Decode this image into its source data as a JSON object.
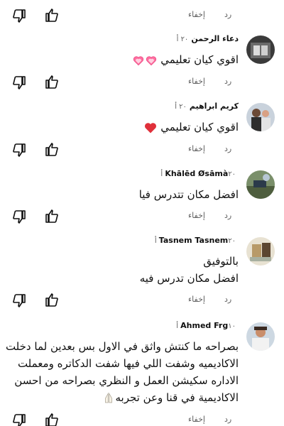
{
  "actions": {
    "reply_label": "رد",
    "hide_label": "إخفاء"
  },
  "comments": [
    {
      "author": "دعاء الرحمن",
      "time": "٢٠ أ",
      "lines": [
        "اقوي كيان تعليمي"
      ]
    },
    {
      "author": "كريم ابراهيم",
      "time": "٢٠ أ",
      "lines": [
        "اقوي كيان تعليمي"
      ]
    },
    {
      "author": "Khālēd Øsāmà",
      "time": "٢٠ أ",
      "lines": [
        "افضل مكان تتدرس فيا"
      ]
    },
    {
      "author": "Tasnem Tasnem",
      "time": "٢٠ أ",
      "lines": [
        "بالتوفيق",
        "افضل مكان تدرس فيه"
      ]
    },
    {
      "author": "Ahmed Frg",
      "time": "١٠ أ",
      "lines": [
        "بصراحه ما كنتش واثق في الاول بس بعدين لما دخلت",
        "الاكاديميه وشفت اللي فيها شفت الدكاتره ومعملت",
        "الاداره سكيشن العمل و النظري بصراحه من احسن",
        "الاكاديمية في قنا وعن تجربه"
      ]
    }
  ],
  "icons": {
    "like": "thumbs-up-icon",
    "dislike": "thumbs-down-icon",
    "heart": "pink-heart-icon",
    "red_heart": "red-heart-icon",
    "folded_hands": "folded-hands-icon"
  },
  "colors": {
    "text": "#0f0f0f",
    "secondary": "#606060",
    "heart_red": "#e0303a",
    "heart_pink": "#ff6fa0"
  }
}
